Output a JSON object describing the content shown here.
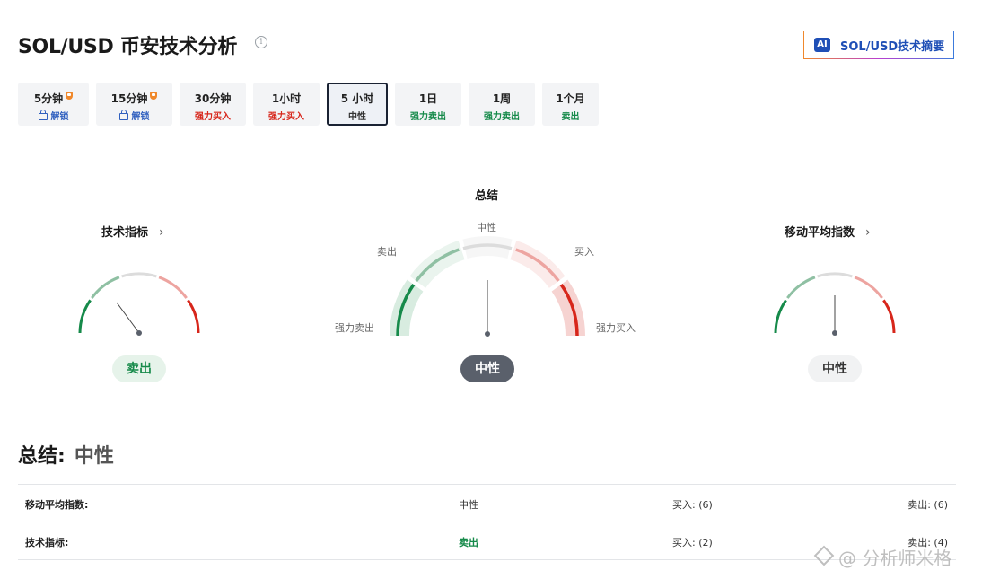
{
  "header": {
    "title": "SOL/USD 币安技术分析",
    "ai_badge": "AI",
    "ai_button_label": "SOL/USD技术摘要"
  },
  "tabs": [
    {
      "label": "5分钟",
      "status": "解锁",
      "locked": true
    },
    {
      "label": "15分钟",
      "status": "解锁",
      "locked": true
    },
    {
      "label": "30分钟",
      "status": "强力买入"
    },
    {
      "label": "1小时",
      "status": "强力买入"
    },
    {
      "label": "5 小时",
      "status": "中性",
      "active": true
    },
    {
      "label": "1日",
      "status": "强力卖出"
    },
    {
      "label": "1周",
      "status": "强力卖出"
    },
    {
      "label": "1个月",
      "status": "卖出"
    }
  ],
  "gauges": {
    "technical": {
      "title": "技术指标",
      "result": "卖出"
    },
    "summary": {
      "title": "总结",
      "result": "中性",
      "scale": {
        "strong_sell": "强力卖出",
        "sell": "卖出",
        "neutral": "中性",
        "buy": "买入",
        "strong_buy": "强力买入"
      }
    },
    "moving_average": {
      "title": "移动平均指数",
      "result": "中性"
    }
  },
  "summary": {
    "heading": "总结:",
    "value": "中性",
    "rows": [
      {
        "name": "移动平均指数:",
        "status": "中性",
        "buy": "买入: (6)",
        "sell": "卖出: (6)"
      },
      {
        "name": "技术指标:",
        "status": "卖出",
        "buy": "买入: (2)",
        "sell": "卖出: (4)"
      }
    ]
  },
  "watermark": "@ 分析师米格",
  "colors": {
    "strong_sell": "#168a4a",
    "sell": "#7fb895",
    "neutral": "#dcdcdc",
    "buy": "#eda4a0",
    "strong_buy": "#d7261b",
    "dark_pill": "#5a606b",
    "accent_blue": "#1f4fb6"
  }
}
